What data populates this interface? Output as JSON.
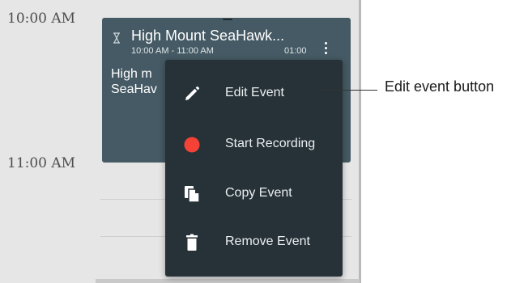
{
  "calendar": {
    "times": [
      "10:00 AM",
      "11:00 AM"
    ]
  },
  "event": {
    "title": "High Mount SeaHawk...",
    "time_range": "10:00 AM - 11:00 AM",
    "duration": "01:00",
    "description_line1": "High m",
    "description_line2": "SeaHav"
  },
  "context_menu": {
    "items": [
      {
        "label": "Edit Event",
        "icon": "pencil-icon"
      },
      {
        "label": "Start Recording",
        "icon": "record-dot-icon",
        "color": "#f44336"
      },
      {
        "label": "Copy Event",
        "icon": "copy-icon"
      },
      {
        "label": "Remove Event",
        "icon": "trash-icon"
      }
    ]
  },
  "annotation": {
    "label": "Edit event button"
  },
  "colors": {
    "event_bg": "#455a64",
    "menu_bg": "#263238",
    "record": "#f44336"
  }
}
